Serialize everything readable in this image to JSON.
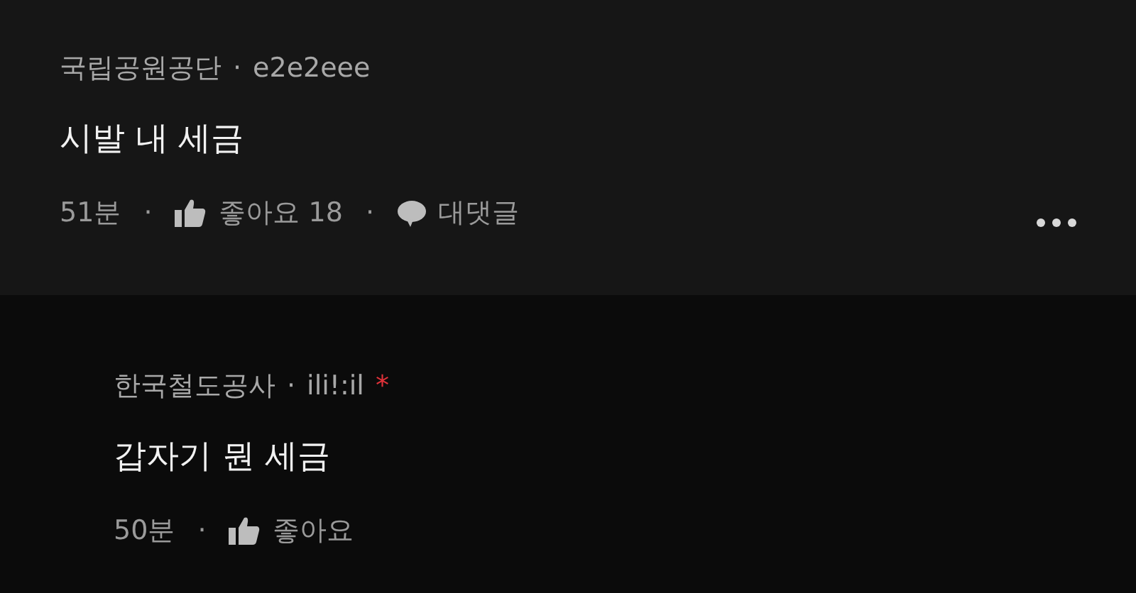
{
  "comments": [
    {
      "kind": "comment",
      "company": "국립공원공단",
      "separator": "·",
      "author": "e2e2eee",
      "text": "시발 내 세금",
      "time": "51분",
      "like_label": "좋아요",
      "like_count": "18",
      "reply_label": "대댓글",
      "has_menu": true
    },
    {
      "kind": "reply",
      "company": "한국철도공사",
      "separator": "·",
      "author": "ili!:il",
      "author_mark": "*",
      "text": "갑자기 뭔 세금",
      "time": "50분",
      "like_label": "좋아요"
    }
  ]
}
